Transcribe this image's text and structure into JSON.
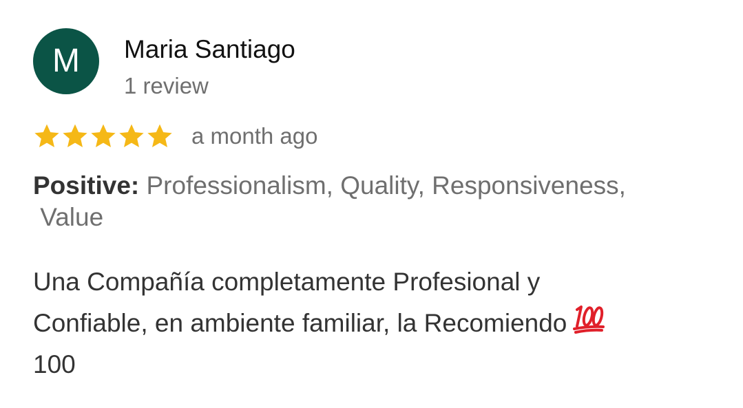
{
  "reviewer": {
    "initial": "M",
    "avatar_color": "#0b5446",
    "name": "Maria Santiago",
    "review_count": "1 review"
  },
  "rating": {
    "stars": 5,
    "max_stars": 5,
    "star_color": "#f5b817",
    "date": "a month ago"
  },
  "attributes": {
    "label": "Positive:",
    "values": "Professionalism, Quality, Responsiveness,",
    "values_continued": " Value"
  },
  "review": {
    "text_line1": "Una Compañía completamente Profesional y",
    "text_line2": "Confiable, en ambiente familiar, la Recomiendo",
    "emoji": "hundred-points-icon",
    "text_line3": "100"
  }
}
